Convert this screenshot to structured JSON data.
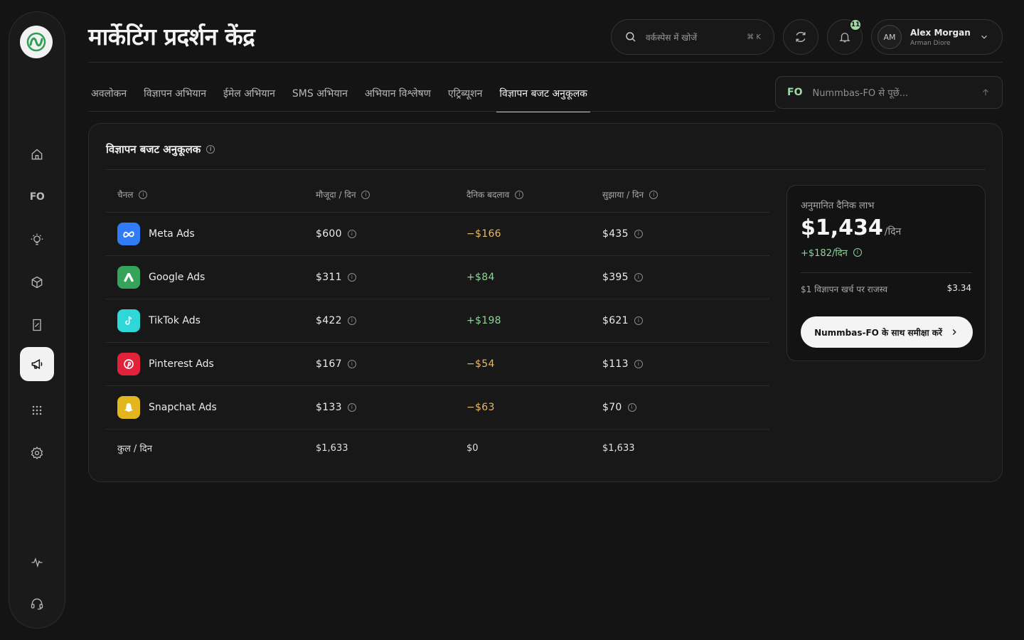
{
  "app": {
    "page_title": "मार्केटिंग प्रदर्शन केंद्र"
  },
  "sidebar": {
    "fo_label": "FO",
    "items": [
      {
        "name": "home-icon"
      },
      {
        "name": "fo-icon"
      },
      {
        "name": "lightbulb-icon"
      },
      {
        "name": "cube-icon"
      },
      {
        "name": "receipt-icon"
      },
      {
        "name": "megaphone-icon",
        "active": true
      },
      {
        "name": "apps-grid-icon"
      },
      {
        "name": "gear-icon"
      },
      {
        "name": "pulse-icon"
      },
      {
        "name": "headset-icon"
      }
    ]
  },
  "header": {
    "search_placeholder": "वर्कस्पेस में खोजें",
    "search_shortcut": "⌘ K",
    "notifications_count": "11",
    "user": {
      "initials": "AM",
      "name": "Alex Morgan",
      "subtitle": "Arman Diore"
    }
  },
  "tabs": [
    {
      "label": "अवलोकन"
    },
    {
      "label": "विज्ञापन अभियान"
    },
    {
      "label": "ईमेल अभियान"
    },
    {
      "label": "SMS अभियान"
    },
    {
      "label": "अभियान विश्लेषण"
    },
    {
      "label": "एट्रिब्यूशन"
    },
    {
      "label": "विज्ञापन बजट अनुकूलक",
      "active": true
    }
  ],
  "assistant": {
    "fo_label": "FO",
    "placeholder": "Nummbas-FO से पूछें..."
  },
  "optimizer": {
    "title": "विज्ञापन बजट अनुकूलक",
    "columns": {
      "channel": "चैनल",
      "current": "मौजूदा / दिन",
      "change": "दैनिक बदलाव",
      "suggested": "सुझाया / दिन"
    },
    "rows": [
      {
        "channel": "Meta Ads",
        "current": "$600",
        "change": "−$166",
        "suggested": "$435",
        "color": "#2f7cf6",
        "trend": "negative"
      },
      {
        "channel": "Google Ads",
        "current": "$311",
        "change": "+$84",
        "suggested": "$395",
        "color": "#35a35a",
        "trend": "positive"
      },
      {
        "channel": "TikTok Ads",
        "current": "$422",
        "change": "+$198",
        "suggested": "$621",
        "color": "#2ed8d8",
        "trend": "positive"
      },
      {
        "channel": "Pinterest Ads",
        "current": "$167",
        "change": "−$54",
        "suggested": "$113",
        "color": "#e1223a",
        "trend": "negative"
      },
      {
        "channel": "Snapchat Ads",
        "current": "$133",
        "change": "−$63",
        "suggested": "$70",
        "color": "#e4b61d",
        "trend": "negative"
      }
    ],
    "total": {
      "label": "कुल / दिन",
      "current": "$1,633",
      "change": "$0",
      "suggested": "$1,633"
    }
  },
  "profit": {
    "label": "अनुमानित दैनिक लाभ",
    "value": "$1,434",
    "unit": "/दिन",
    "delta": "+$182/दिन",
    "roas_label": "$1 विज्ञापन खर्च पर राजस्व",
    "roas_value": "$3.34",
    "cta": "Nummbas-FO के साथ समीक्षा करें"
  },
  "colors": {
    "accent": "#9ed9a7",
    "negative": "#e8b86a",
    "positive": "#8ed39b"
  }
}
